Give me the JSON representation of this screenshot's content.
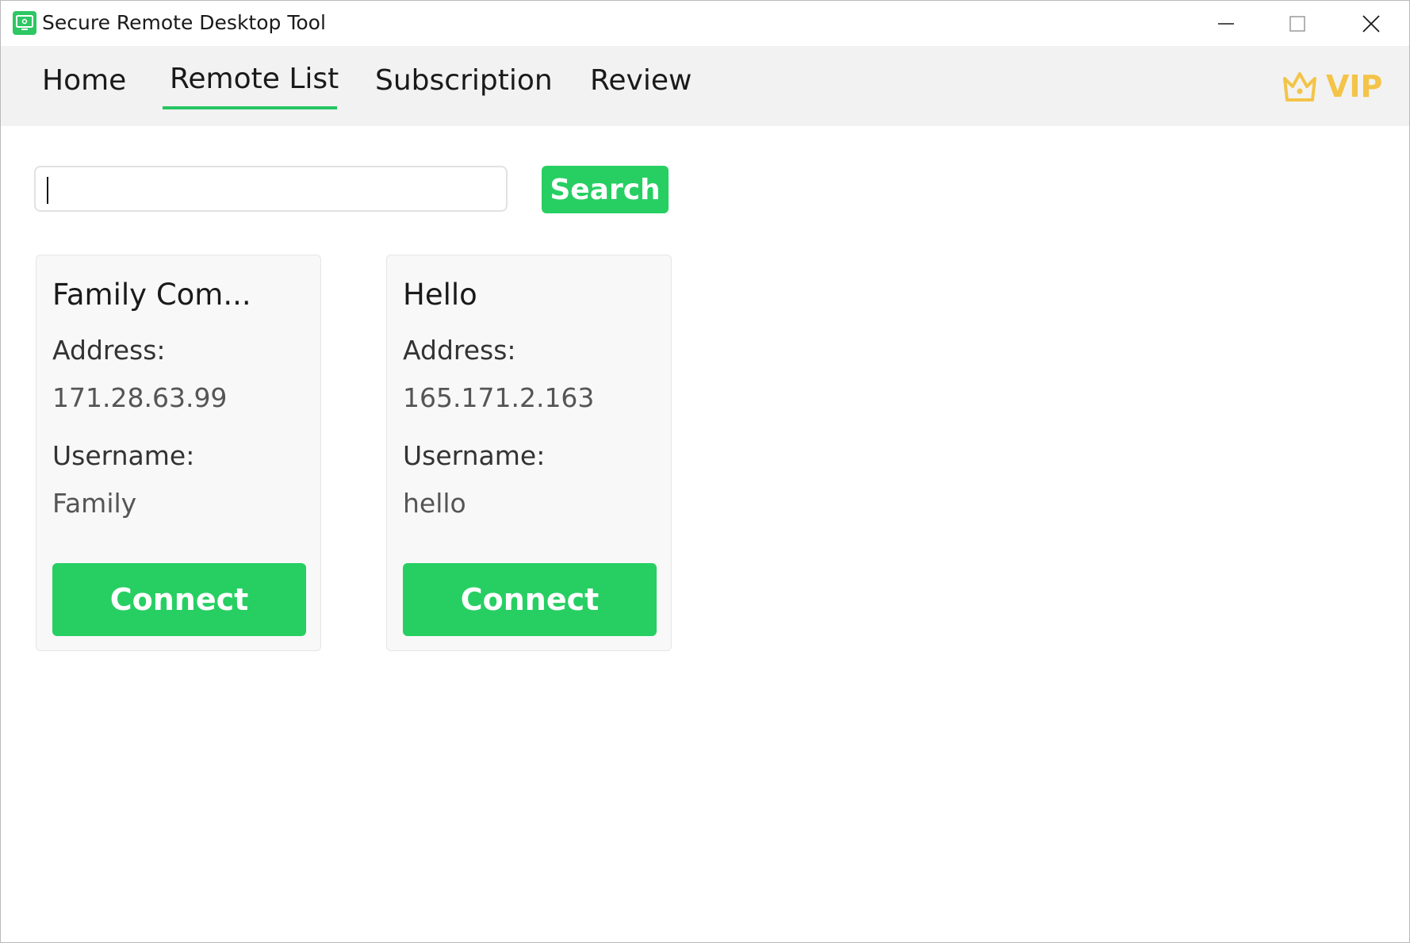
{
  "window": {
    "title": "Secure Remote Desktop Tool",
    "icon": "monitor-app-icon"
  },
  "nav": {
    "tabs": [
      {
        "label": "Home",
        "active": false
      },
      {
        "label": "Remote List",
        "active": true
      },
      {
        "label": "Subscription",
        "active": false
      },
      {
        "label": "Review",
        "active": false
      }
    ],
    "vip_label": "VIP"
  },
  "search": {
    "value": "",
    "placeholder": "",
    "button_label": "Search"
  },
  "devices": [
    {
      "name": "Family Com...",
      "address_label": "Address:",
      "address": "171.28.63.99",
      "username_label": "Username:",
      "username": "Family",
      "connect_label": "Connect"
    },
    {
      "name": "Hello",
      "address_label": "Address:",
      "address": "165.171.2.163",
      "username_label": "Username:",
      "username": "hello",
      "connect_label": "Connect"
    }
  ],
  "colors": {
    "accent": "#27cf63",
    "vip": "#f3c449",
    "nav_background": "#f2f2f2"
  }
}
